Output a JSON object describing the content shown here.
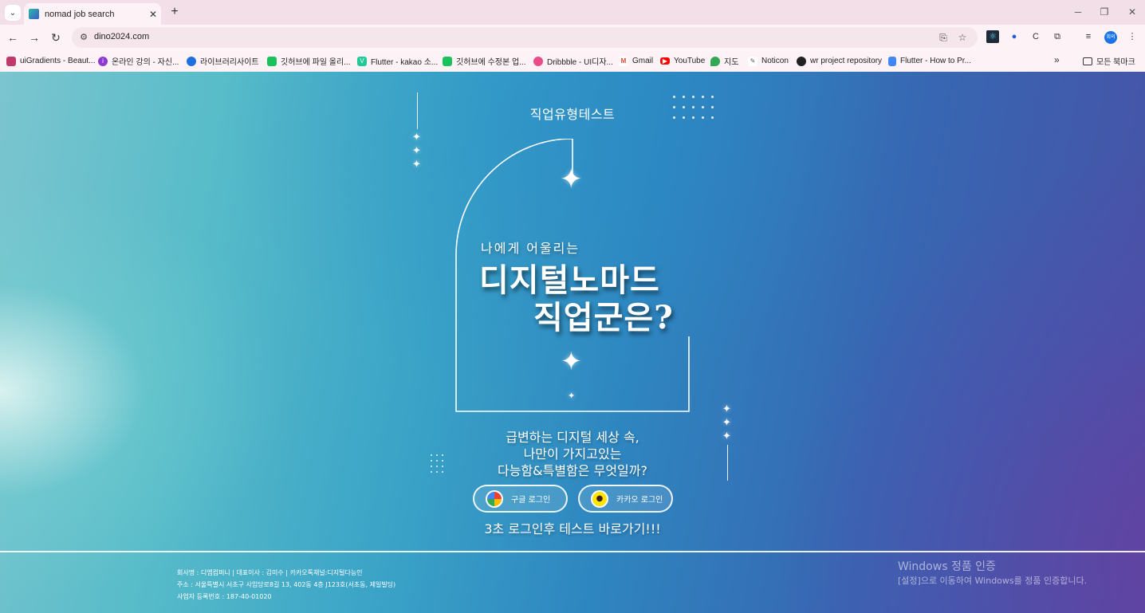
{
  "browser": {
    "tab_title": "nomad job search",
    "new_tab_label": "+",
    "url": "dino2024.com",
    "profile_initials": "회의"
  },
  "bookmarks": [
    {
      "label": "uiGradients - Beaut...",
      "icon": "uigradients-icon",
      "color": "#c0396b"
    },
    {
      "label": "온라인 강의 - 자신...",
      "icon": "inflearn-icon",
      "color": "#8e3ad1"
    },
    {
      "label": "라이브러리사이트",
      "icon": "library-icon",
      "color": "#1f6fe0"
    },
    {
      "label": "깃허브에 파일 올리...",
      "icon": "naver-blog-icon",
      "color": "#19c25a"
    },
    {
      "label": "Flutter - kakao 소...",
      "icon": "velog-icon",
      "color": "#20c997"
    },
    {
      "label": "깃허브에 수정본 업...",
      "icon": "naver-blog-icon",
      "color": "#19c25a"
    },
    {
      "label": "Dribbble - UI디자...",
      "icon": "dribbble-icon",
      "color": "#ea4c89"
    },
    {
      "label": "Gmail",
      "icon": "gmail-icon",
      "color": "#ea4335"
    },
    {
      "label": "YouTube",
      "icon": "youtube-icon",
      "color": "#ff0000"
    },
    {
      "label": "지도",
      "icon": "maps-icon",
      "color": "#34a853"
    },
    {
      "label": "Noticon",
      "icon": "noticon-icon",
      "color": "#555555"
    },
    {
      "label": "wr project repository",
      "icon": "github-icon",
      "color": "#222222"
    },
    {
      "label": "Flutter - How to Pr...",
      "icon": "document-icon",
      "color": "#4285f4"
    }
  ],
  "bookmark_folder": "모든 북마크",
  "page": {
    "title": "직업유형테스트",
    "hero_sub": "나에게 어울리는",
    "hero_line1": "디지털노마드",
    "hero_line2": "직업군은?",
    "desc_line1": "급변하는 디지털 세상 속,",
    "desc_line2": "나만이 가지고있는",
    "desc_line3": "다능함&특별함은 무엇일까?",
    "google_login": "구글 로그인",
    "kakao_login": "카카오 로그인",
    "cta": "3초 로그인후 테스트 바로가기!!!"
  },
  "footer": {
    "line1": "회사명 : 디엠컴퍼니 | 대표이사 : 김미수 | 카카오톡채널:디지털다능인",
    "line2": "주소 : 서울특별시 서초구 사임당로8길 13, 402동 4층 J123호(서초동, 제일빌딩)",
    "line3": "사업자 등록번호 : 187-40-01020"
  },
  "windows_watermark": {
    "title": "Windows 정품 인증",
    "subtitle": "[설정]으로 이동하여 Windows를 정품 인증합니다."
  },
  "colors": {
    "tabbar": "#f3dfe7",
    "toolbar": "#fdf3f6",
    "gradient_left": "#7bc5cf",
    "gradient_right": "#4a4fa5"
  }
}
